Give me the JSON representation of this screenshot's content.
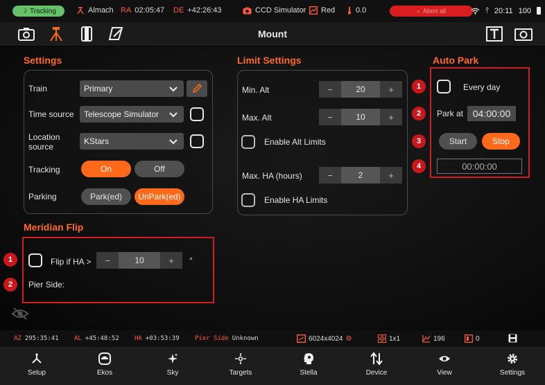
{
  "status_bar": {
    "tracking": "Tracking",
    "site": "Almach",
    "ra_label": "RA",
    "ra_value": "02:05:47",
    "de_label": "DE",
    "de_value": "+42:26:43",
    "camera": "CCD Simulator",
    "filter": "Red",
    "temperature": "0.0",
    "abort": "Abort all",
    "clock": "20:11",
    "battery": "100"
  },
  "title_bar": {
    "title": "Mount"
  },
  "settings": {
    "title": "Settings",
    "train_label": "Train",
    "train_value": "Primary",
    "time_source_label": "Time source",
    "time_source_value": "Telescope Simulator",
    "location_label_1": "Location",
    "location_label_2": "source",
    "location_value": "KStars",
    "tracking_label": "Tracking",
    "tracking_on": "On",
    "tracking_off": "Off",
    "parking_label": "Parking",
    "park": "Park(ed)",
    "unpark": "UnPark(ed)"
  },
  "limits": {
    "title": "Limit Settings",
    "min_alt_label": "Min. Alt",
    "min_alt_value": "20",
    "max_alt_label": "Max. Alt",
    "max_alt_value": "10",
    "enable_alt": "Enable Alt Limits",
    "max_ha_label": "Max. HA (hours)",
    "max_ha_value": "2",
    "enable_ha": "Enable HA Limits",
    "minus": "−",
    "plus": "+"
  },
  "auto_park": {
    "title": "Auto Park",
    "every_day": "Every day",
    "park_at_label": "Park at",
    "park_at_value": "04:00:00",
    "start": "Start",
    "stop": "Stop",
    "countdown": "00:00:00",
    "badges": [
      "1",
      "2",
      "3",
      "4"
    ]
  },
  "meridian": {
    "title": "Meridian Flip",
    "flip_label": "Flip if HA >",
    "flip_value": "10",
    "degree": "°",
    "pier_side_label": "Pier Side:",
    "badges": [
      "1",
      "2"
    ]
  },
  "info_bar": {
    "az_label": "AZ",
    "az_value": "295:35:41",
    "al_label": "AL",
    "al_value": "+45:48:52",
    "ha_label": "HA",
    "ha_value": "+03:53:39",
    "pier_label": "Pier Side",
    "pier_value": "Unknown",
    "resolution": "6024x4024",
    "binning": "1x1",
    "stat_a": "196",
    "stat_b": "0"
  },
  "bottom_nav": [
    "Setup",
    "Ekos",
    "Sky",
    "Targets",
    "Stella",
    "Device",
    "View",
    "Settings"
  ],
  "colors": {
    "accent": "#ff6a1a",
    "highlight_box": "#d11f1f",
    "tracking_green": "#67c06a",
    "abort_red": "#d81e1e"
  }
}
